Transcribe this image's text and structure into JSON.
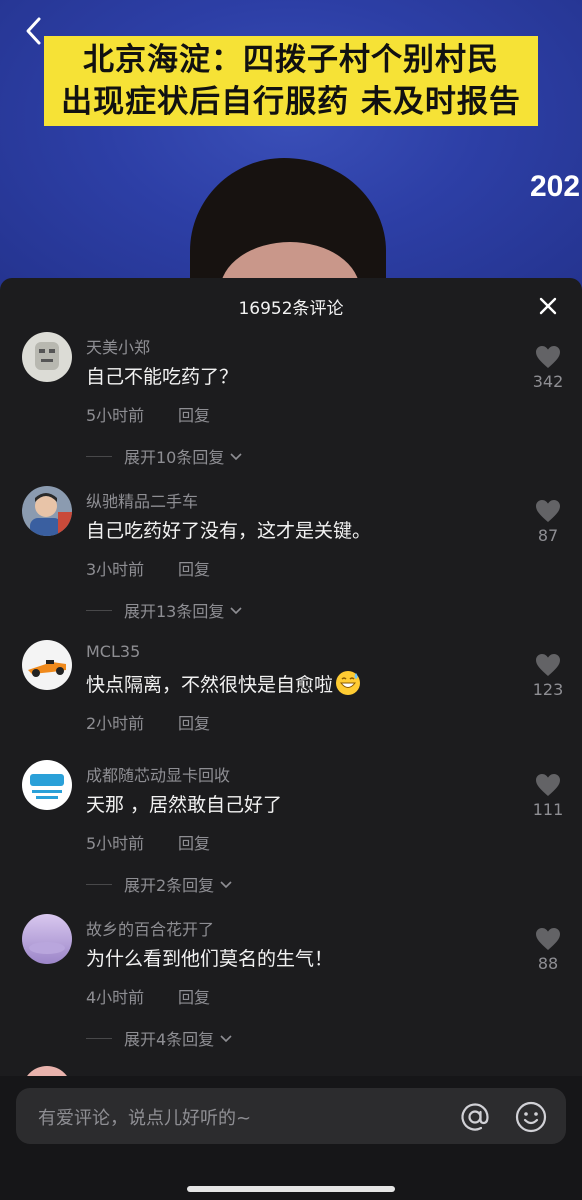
{
  "video": {
    "headline_line1": "北京海淀：四拨子村个别村民",
    "headline_line2": "出现症状后自行服药 未及时报告",
    "year_fragment": "202"
  },
  "panel": {
    "title": "16952条评论"
  },
  "comments": [
    {
      "user": "天美小郑",
      "text": "自己不能吃药了？",
      "time": "5小时前",
      "reply": "回复",
      "likes": "342",
      "expand": "展开10条回复"
    },
    {
      "user": "纵驰精品二手车",
      "text": "自己吃药好了没有，这才是关键。",
      "time": "3小时前",
      "reply": "回复",
      "likes": "87",
      "expand": "展开13条回复"
    },
    {
      "user": "MCL35",
      "text": "快点隔离，不然很快是自愈啦",
      "time": "2小时前",
      "reply": "回复",
      "likes": "123"
    },
    {
      "user": "成都随芯动显卡回收",
      "text": "天那 ，居然敢自己好了",
      "time": "5小时前",
      "reply": "回复",
      "likes": "111",
      "expand": "展开2条回复"
    },
    {
      "user": "故乡的百合花开了",
      "text": "为什么看到他们莫名的生气！",
      "time": "4小时前",
      "reply": "回复",
      "likes": "88",
      "expand": "展开4条回复"
    }
  ],
  "input": {
    "placeholder": "有爱评论，说点儿好听的~"
  },
  "colors": {
    "video_background": "#2d3fa6",
    "headline_background": "#f6e236",
    "panel_background": "#1c1c1e",
    "secondary_text": "#8e8e93"
  },
  "icons": {
    "back": "chevron-left-icon",
    "close": "close-icon",
    "like": "heart-icon",
    "expand": "chevron-down-icon",
    "mention": "at-sign-icon",
    "emoji": "smiley-icon"
  }
}
